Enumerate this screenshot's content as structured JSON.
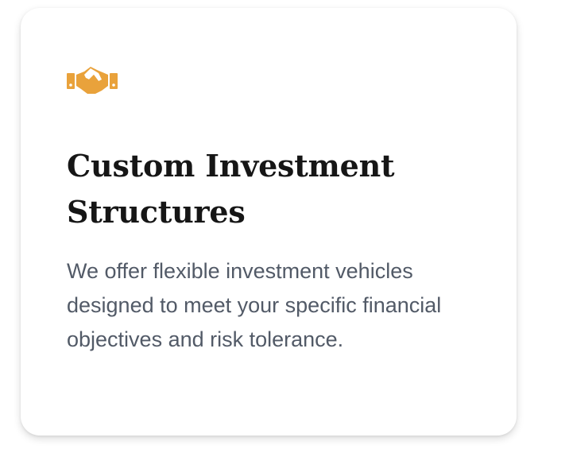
{
  "card": {
    "icon": "handshake-icon",
    "icon_color": "#e9a23b",
    "title": "Custom Investment Structures",
    "description": "We offer flexible investment vehicles designed to meet your specific financial objectives and risk tolerance."
  }
}
